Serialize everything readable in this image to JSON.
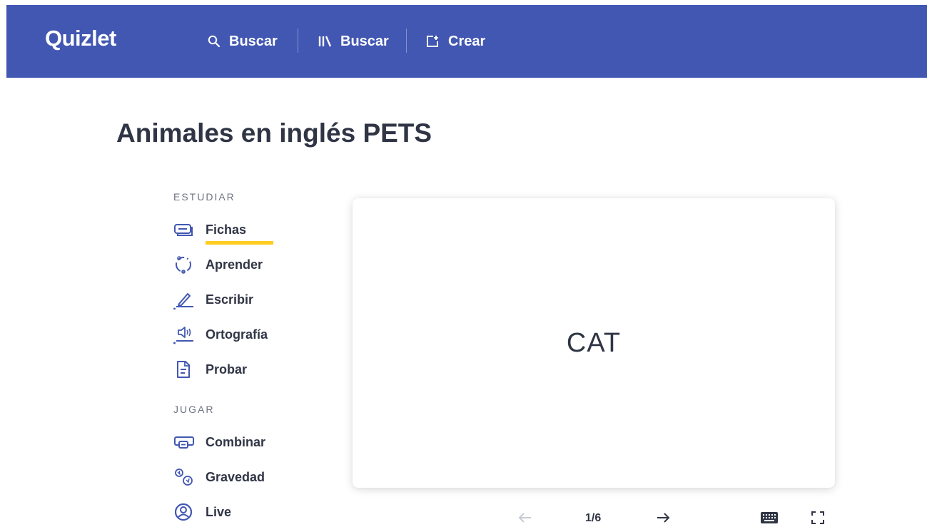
{
  "header": {
    "logo": "Quizlet",
    "nav": [
      {
        "label": "Buscar",
        "icon": "search-icon"
      },
      {
        "label": "Buscar",
        "icon": "library-icon"
      },
      {
        "label": "Crear",
        "icon": "create-icon"
      }
    ],
    "background_color": "#4257b2"
  },
  "set_title": "Animales en inglés PETS",
  "sidebar": {
    "study_label": "ESTUDIAR",
    "study_modes": [
      {
        "label": "Fichas",
        "icon": "flashcards-icon",
        "active": true
      },
      {
        "label": "Aprender",
        "icon": "learn-icon"
      },
      {
        "label": "Escribir",
        "icon": "write-icon"
      },
      {
        "label": "Ortografía",
        "icon": "spell-icon"
      },
      {
        "label": "Probar",
        "icon": "test-icon"
      }
    ],
    "play_label": "JUGAR",
    "play_modes": [
      {
        "label": "Combinar",
        "icon": "match-icon"
      },
      {
        "label": "Gravedad",
        "icon": "gravity-icon"
      },
      {
        "label": "Live",
        "icon": "live-icon"
      }
    ],
    "active_underline_color": "#ffcd1f"
  },
  "card": {
    "term": "CAT"
  },
  "controls": {
    "counter": "1/6",
    "prev_icon": "arrow-left-icon",
    "next_icon": "arrow-right-icon",
    "keyboard_icon": "keyboard-icon",
    "fullscreen_icon": "fullscreen-icon"
  }
}
